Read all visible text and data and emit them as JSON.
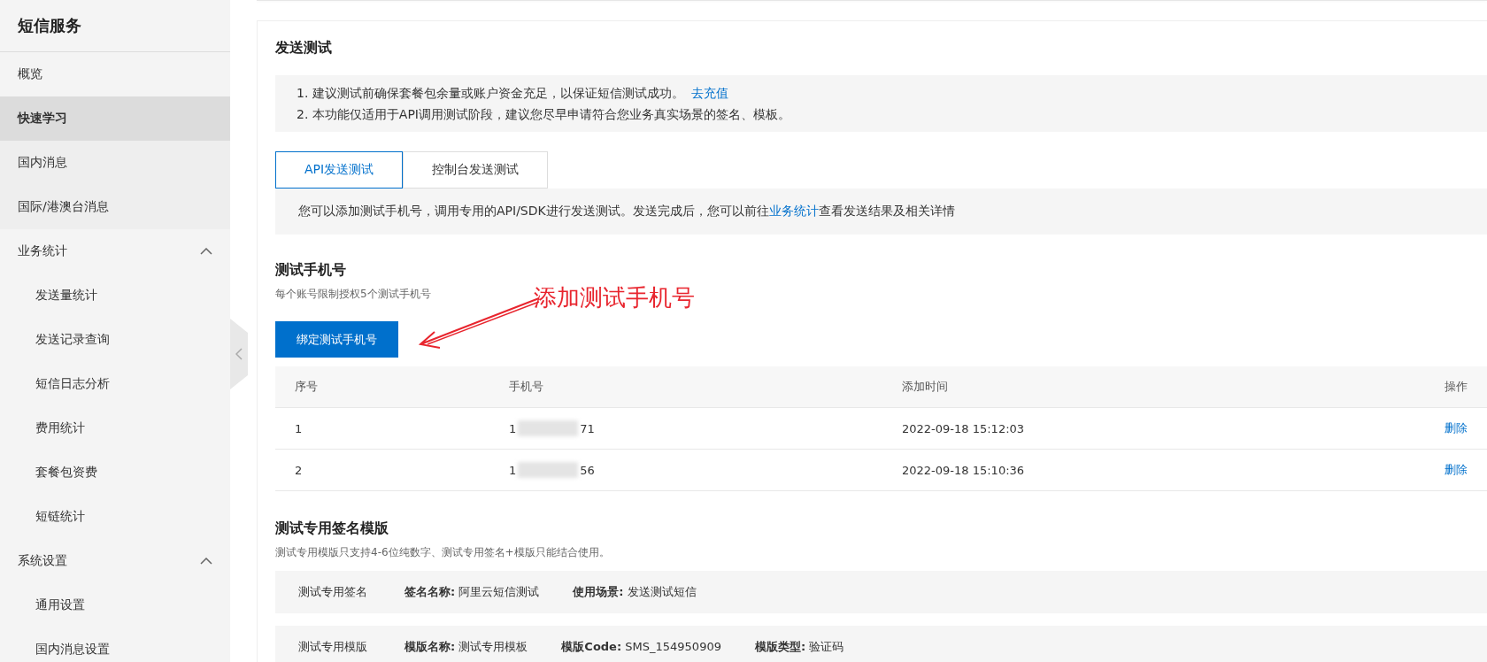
{
  "sidebar": {
    "title": "短信服务",
    "items": [
      {
        "label": "概览",
        "kind": "item",
        "selected": false
      },
      {
        "label": "快速学习",
        "kind": "item",
        "selected": true
      },
      {
        "label": "国内消息",
        "kind": "item",
        "selected": false
      },
      {
        "label": "国际/港澳台消息",
        "kind": "item",
        "selected": false
      },
      {
        "label": "业务统计",
        "kind": "group",
        "expanded": true,
        "children": [
          {
            "label": "发送量统计",
            "selected": false
          },
          {
            "label": "发送记录查询",
            "selected": false
          },
          {
            "label": "短信日志分析",
            "selected": false
          },
          {
            "label": "费用统计",
            "selected": false
          },
          {
            "label": "套餐包资费",
            "selected": false
          },
          {
            "label": "短链统计",
            "selected": false
          }
        ]
      },
      {
        "label": "系统设置",
        "kind": "group",
        "expanded": true,
        "children": [
          {
            "label": "通用设置",
            "selected": false
          },
          {
            "label": "国内消息设置",
            "selected": false
          }
        ]
      }
    ]
  },
  "main": {
    "title": "发送测试",
    "notices": [
      {
        "text": "1. 建议测试前确保套餐包余量或账户资金充足，以保证短信测试成功。",
        "link": "去充值"
      },
      {
        "text": "2. 本功能仅适用于API调用测试阶段，建议您尽早申请符合您业务真实场景的签名、模板。"
      }
    ],
    "tabs": [
      {
        "label": "API发送测试",
        "selected": true
      },
      {
        "label": "控制台发送测试",
        "selected": false
      }
    ],
    "info": {
      "before": "您可以添加测试手机号，调用专用的API/SDK进行发送测试。发送完成后，您可以前往",
      "link": "业务统计",
      "after": "查看发送结果及相关详情"
    },
    "phones": {
      "title": "测试手机号",
      "subtitle": "每个账号限制授权5个测试手机号",
      "button": "绑定测试手机号",
      "annotation": "添加测试手机号",
      "columns": [
        "序号",
        "手机号",
        "添加时间",
        "操作"
      ],
      "rows": [
        {
          "index": "1",
          "phone_start": "1",
          "phone_end": "71",
          "time": "2022-09-18 15:12:03",
          "action": "删除"
        },
        {
          "index": "2",
          "phone_start": "1",
          "phone_end": "56",
          "time": "2022-09-18 15:10:36",
          "action": "删除"
        }
      ]
    },
    "templates": {
      "title": "测试专用签名模版",
      "subtitle": "测试专用模版只支持4-6位纯数字、测试专用签名+模版只能结合使用。",
      "rows": [
        {
          "label": "测试专用签名",
          "fields": [
            {
              "key": "签名名称:",
              "value": "阿里云短信测试"
            },
            {
              "key": "使用场景:",
              "value": "发送测试短信"
            }
          ]
        },
        {
          "label": "测试专用模版",
          "fields": [
            {
              "key": "模版名称:",
              "value": "测试专用模板"
            },
            {
              "key": "模版Code:",
              "value": "SMS_154950909"
            },
            {
              "key": "模版类型:",
              "value": "验证码"
            }
          ]
        }
      ]
    }
  }
}
